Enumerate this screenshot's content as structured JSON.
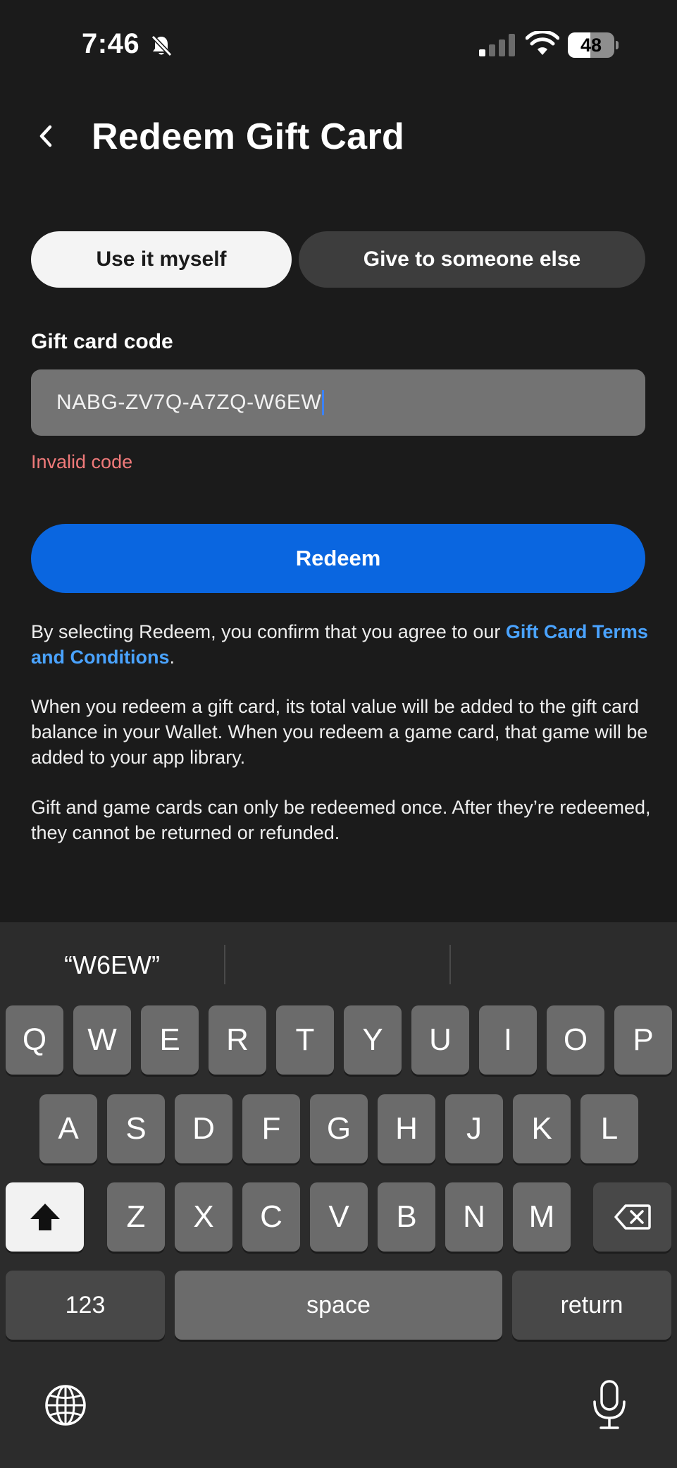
{
  "status_bar": {
    "time": "7:46",
    "battery_level": "48",
    "battery_fraction": 0.48
  },
  "header": {
    "title": "Redeem Gift Card"
  },
  "options": {
    "use_myself": "Use it myself",
    "give_to_someone": "Give to someone else",
    "selected": "use_myself"
  },
  "form": {
    "label": "Gift card code",
    "code_value": "NABG-ZV7Q-A7ZQ-W6EW",
    "error": "Invalid code",
    "redeem_label": "Redeem"
  },
  "info": {
    "p1_text": "By selecting Redeem, you confirm that you agree to our ",
    "p1_link": "Gift Card Terms and Conditions",
    "p1_end": ".",
    "p2": "When you redeem a gift card, its total value will be added to the gift card balance in your Wallet. When you redeem a game card, that game will be added to your app library.",
    "p3": "Gift and game cards can only be redeemed once. After they’re redeemed, they cannot be returned or refunded."
  },
  "keyboard": {
    "suggestion": "“W6EW”",
    "row1": [
      "Q",
      "W",
      "E",
      "R",
      "T",
      "Y",
      "U",
      "I",
      "O",
      "P"
    ],
    "row2": [
      "A",
      "S",
      "D",
      "F",
      "G",
      "H",
      "J",
      "K",
      "L"
    ],
    "row3": [
      "Z",
      "X",
      "C",
      "V",
      "B",
      "N",
      "M"
    ],
    "numbers_label": "123",
    "space_label": "space",
    "return_label": "return",
    "icons": {
      "shift": "shift-icon",
      "delete": "backspace-icon",
      "globe": "globe-icon",
      "mic": "microphone-icon"
    }
  },
  "colors": {
    "background": "#1b1b1b",
    "accent": "#0a66e0",
    "link": "#4aa3ff",
    "error": "#f07a7a"
  }
}
